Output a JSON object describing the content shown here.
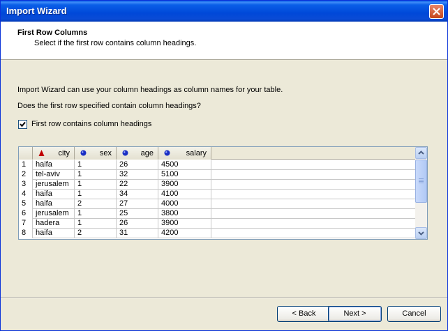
{
  "window": {
    "title": "Import Wizard"
  },
  "header": {
    "title": "First Row Columns",
    "subtitle": "Select if the first row contains column headings."
  },
  "body": {
    "intro": "Import Wizard can use your column headings as column names for your table.",
    "question": "Does the first row specified contain column headings?",
    "checkbox_label": "First row contains column headings",
    "checkbox_checked": true
  },
  "grid": {
    "columns": [
      {
        "label": "city",
        "icon": "text-type-icon",
        "icon_color": "#c00000"
      },
      {
        "label": "sex",
        "icon": "numeric-type-icon",
        "icon_color": "#1a2fc4"
      },
      {
        "label": "age",
        "icon": "numeric-type-icon",
        "icon_color": "#1a2fc4"
      },
      {
        "label": "salary",
        "icon": "numeric-type-icon",
        "icon_color": "#1a2fc4"
      }
    ],
    "rows": [
      {
        "n": "1",
        "city": "haifa",
        "sex": "1",
        "age": "26",
        "salary": "4500"
      },
      {
        "n": "2",
        "city": "tel-aviv",
        "sex": "1",
        "age": "32",
        "salary": "5100"
      },
      {
        "n": "3",
        "city": "jerusalem",
        "sex": "1",
        "age": "22",
        "salary": "3900"
      },
      {
        "n": "4",
        "city": "haifa",
        "sex": "1",
        "age": "34",
        "salary": "4100"
      },
      {
        "n": "5",
        "city": "haifa",
        "sex": "2",
        "age": "27",
        "salary": "4000"
      },
      {
        "n": "6",
        "city": "jerusalem",
        "sex": "1",
        "age": "25",
        "salary": "3800"
      },
      {
        "n": "7",
        "city": "hadera",
        "sex": "1",
        "age": "26",
        "salary": "3900"
      },
      {
        "n": "8",
        "city": "haifa",
        "sex": "2",
        "age": "31",
        "salary": "4200"
      }
    ]
  },
  "buttons": {
    "back": "< Back",
    "next": "Next >",
    "cancel": "Cancel"
  }
}
